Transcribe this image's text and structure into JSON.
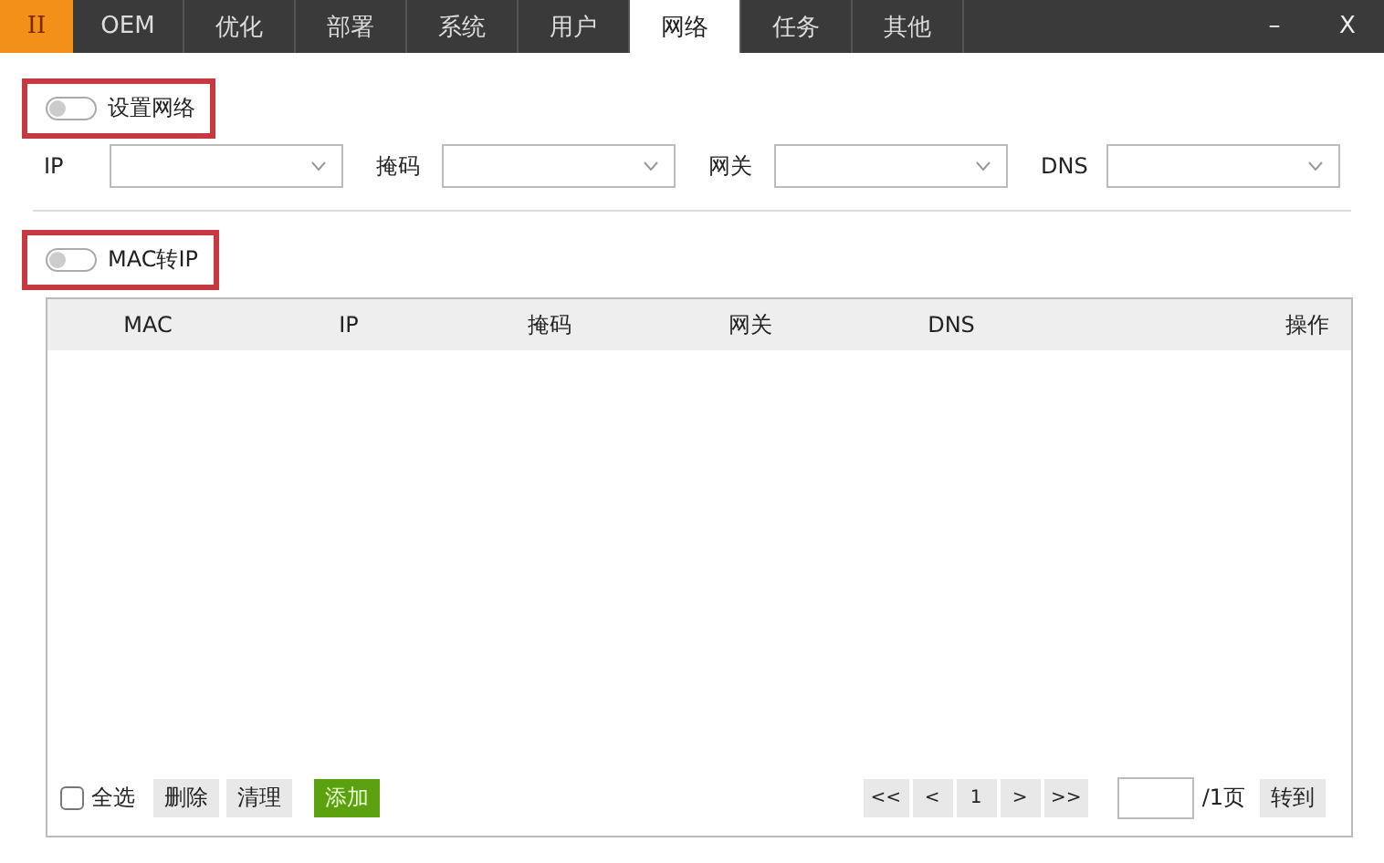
{
  "title_bar": {
    "logo": "II",
    "tabs": [
      {
        "label": "OEM",
        "selected": false
      },
      {
        "label": "优化",
        "selected": false
      },
      {
        "label": "部署",
        "selected": false
      },
      {
        "label": "系统",
        "selected": false
      },
      {
        "label": "用户",
        "selected": false
      },
      {
        "label": "网络",
        "selected": true
      },
      {
        "label": "任务",
        "selected": false
      },
      {
        "label": "其他",
        "selected": false
      }
    ],
    "minimize": "–",
    "close": "X"
  },
  "network_settings": {
    "toggle": {
      "label": "设置网络",
      "on": false,
      "highlighted": true
    },
    "fields": [
      {
        "label": "IP"
      },
      {
        "label": "掩码"
      },
      {
        "label": "网关"
      },
      {
        "label": "DNS"
      }
    ]
  },
  "mac_to_ip": {
    "toggle": {
      "label": "MAC转IP",
      "on": false,
      "highlighted": true
    },
    "table": {
      "columns": [
        "MAC",
        "IP",
        "掩码",
        "网关",
        "DNS",
        "操作"
      ]
    },
    "footer": {
      "select_all": {
        "label": "全选",
        "checked": false
      },
      "buttons": [
        {
          "label": "删除",
          "kind": "plain"
        },
        {
          "label": "清理",
          "kind": "plain"
        },
        {
          "label": "添加",
          "kind": "primary"
        }
      ],
      "pager": [
        "<<",
        "<",
        "1",
        ">",
        ">>"
      ],
      "page_total": "/1页",
      "goto": "转到"
    }
  }
}
